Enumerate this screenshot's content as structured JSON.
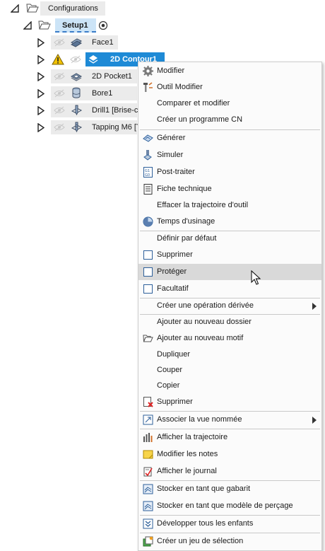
{
  "tree": {
    "configurations": "Configurations",
    "setup": "Setup1",
    "items": [
      {
        "label": "Face1"
      },
      {
        "label": "2D Contour1"
      },
      {
        "label": "2D Pocket1"
      },
      {
        "label": "Bore1"
      },
      {
        "label": "Drill1 [Brise-co"
      },
      {
        "label": "Tapping M6 [T"
      }
    ]
  },
  "menu": {
    "items": [
      {
        "label": "Modifier"
      },
      {
        "label": "Outil Modifier"
      },
      {
        "label": "Comparer et modifier"
      },
      {
        "label": "Créer un programme CN"
      },
      {
        "label": "Générer"
      },
      {
        "label": "Simuler"
      },
      {
        "label": "Post-traiter"
      },
      {
        "label": "Fiche technique"
      },
      {
        "label": "Effacer la trajectoire d'outil"
      },
      {
        "label": "Temps d'usinage"
      },
      {
        "label": "Définir par défaut"
      },
      {
        "label": "Supprimer"
      },
      {
        "label": "Protéger"
      },
      {
        "label": "Facultatif"
      },
      {
        "label": "Créer une opération dérivée"
      },
      {
        "label": "Ajouter au nouveau dossier"
      },
      {
        "label": "Ajouter au nouveau motif"
      },
      {
        "label": "Dupliquer"
      },
      {
        "label": "Couper"
      },
      {
        "label": "Copier"
      },
      {
        "label": "Supprimer"
      },
      {
        "label": "Associer la vue nommée"
      },
      {
        "label": "Afficher la trajectoire"
      },
      {
        "label": "Modifier les notes"
      },
      {
        "label": "Afficher le journal"
      },
      {
        "label": "Stocker en tant que gabarit"
      },
      {
        "label": "Stocker en tant que modèle de perçage"
      },
      {
        "label": "Développer tous les enfants"
      },
      {
        "label": "Créer un jeu de sélection"
      }
    ]
  },
  "colors": {
    "selection": "#1e8ad6",
    "highlight": "#d9d9d9",
    "setup_bg": "#cce4f7",
    "warning": "#f2c200",
    "accent_blue": "#2d5f9a"
  }
}
